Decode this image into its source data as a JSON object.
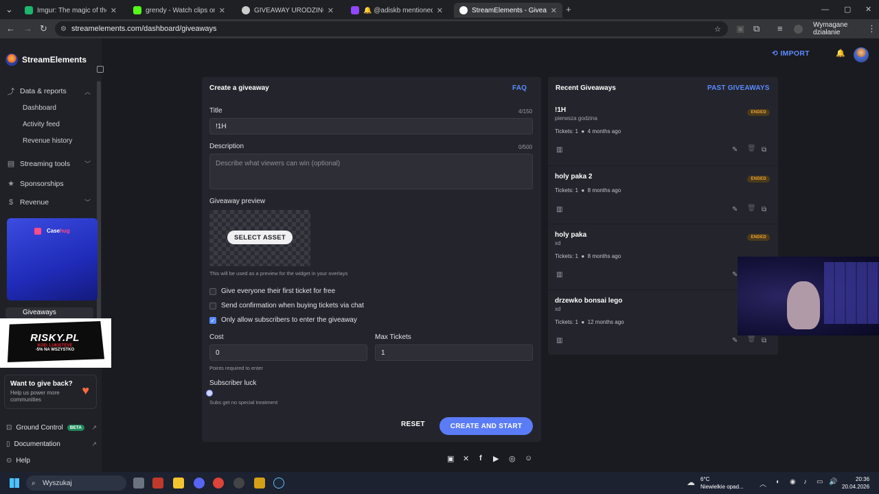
{
  "browser": {
    "tabs": [
      {
        "label": "Imgur: The magic of the Interne",
        "color": "#1bb76e"
      },
      {
        "label": "grendy - Watch clips on Kick",
        "color": "#53fc18"
      },
      {
        "label": "GIVEAWAY URODZINOWY",
        "color": "#cccccc"
      },
      {
        "label": "🔔 @adiskb mentioned you",
        "color": "#9146ff"
      },
      {
        "label": "StreamElements - Giveaways",
        "color": "#ffffff"
      }
    ],
    "new_tab": "+",
    "url": "streamelements.com/dashboard/giveaways",
    "profile_action": "Wymagane działanie"
  },
  "sidebar": {
    "brand": "StreamElements",
    "sections": [
      {
        "label": "Data & reports",
        "icon": "chart-icon"
      },
      {
        "label": "Streaming tools",
        "icon": "broadcast-icon"
      },
      {
        "label": "Sponsorships",
        "icon": "star-icon"
      },
      {
        "label": "Revenue",
        "icon": "dollar-icon"
      }
    ],
    "sub_items": [
      "Dashboard",
      "Activity feed",
      "Revenue history"
    ],
    "promo_brand_a": "Case",
    "promo_brand_b": "hug",
    "active_item": "Giveaways",
    "ad": {
      "title": "RISKY.PL",
      "code": "KOD: LUKISTEVE",
      "discount": "-5% NA WSZYSTKO"
    },
    "giveback": {
      "title": "Want to give back?",
      "subtitle": "Help us power more communities"
    },
    "footer": [
      {
        "label": "Ground Control",
        "badge": "BETA"
      },
      {
        "label": "Documentation"
      },
      {
        "label": "Help"
      }
    ]
  },
  "header": {
    "import_label": "IMPORT"
  },
  "create": {
    "title": "Create a giveaway",
    "faq": "FAQ",
    "title_label": "Title",
    "title_count": "4/150",
    "title_value": "!1H",
    "desc_label": "Description",
    "desc_count": "0/500",
    "desc_placeholder": "Describe what viewers can win (optional)",
    "preview_label": "Giveaway preview",
    "select_asset": "SELECT ASSET",
    "preview_hint": "This will be used as a preview for the widget in your overlays",
    "options": [
      {
        "label": "Give everyone their first ticket for free",
        "checked": false
      },
      {
        "label": "Send confirmation when buying tickets via chat",
        "checked": false
      },
      {
        "label": "Only allow subscribers to enter the giveaway",
        "checked": true
      }
    ],
    "cost_label": "Cost",
    "cost_value": "0",
    "cost_hint": "Points required to enter",
    "max_label": "Max Tickets",
    "max_value": "1",
    "luck_label": "Subscriber luck",
    "luck_hint": "Subs get no special treatment",
    "reset": "RESET",
    "submit": "CREATE AND START"
  },
  "recent": {
    "title": "Recent Giveaways",
    "past_link": "PAST GIVEAWAYS",
    "items": [
      {
        "title": "!1H",
        "subtitle": "pierwsza godzina",
        "tickets": "Tickets: 1",
        "ago": "4 months ago",
        "status": "ENDED"
      },
      {
        "title": "holy paka 2",
        "subtitle": "",
        "tickets": "Tickets: 1",
        "ago": "8 months ago",
        "status": "ENDED"
      },
      {
        "title": "holy paka",
        "subtitle": "xd",
        "tickets": "Tickets: 1",
        "ago": "8 months ago",
        "status": "ENDED"
      },
      {
        "title": "drzewko bonsai lego",
        "subtitle": "xd",
        "tickets": "Tickets: 1",
        "ago": "12 months ago",
        "status": ""
      }
    ]
  },
  "taskbar": {
    "search": "Wyszukaj",
    "temp": "6°C",
    "weather": "Niewielkie opad...",
    "time": "20:36",
    "date": "20.04.2026"
  }
}
